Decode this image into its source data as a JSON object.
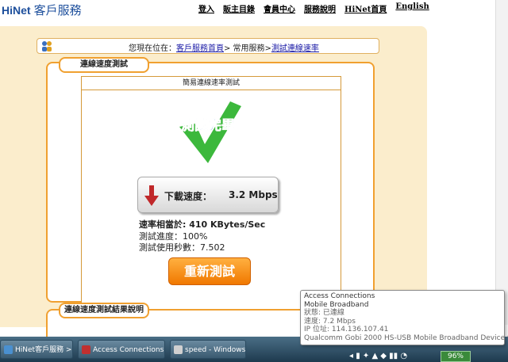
{
  "header": {
    "logo_text": "HiNet",
    "service_title": "客戶服務",
    "nav": [
      "登入",
      "販主目錄",
      "會員中心",
      "服務說明",
      "HiNet首頁",
      "English"
    ]
  },
  "breadcrumb": {
    "prefix": "您現在位在：",
    "home_link": "客戶服務首頁",
    "sep1": "> 常用服務>",
    "current_link": "測試連線速率"
  },
  "speed_panel": {
    "title": "連線速度測試",
    "inner_title": "簡易連線速率測試",
    "done_label": "測試完畢",
    "download_label": "下載速度：",
    "download_value": "3.2 Mbps",
    "equivalent": "速率相當於: 410 KBytes/Sec",
    "progress": "測試進度：100%",
    "elapsed": "測試使用秒數：7.502",
    "retest_button": "重新測試"
  },
  "result_panel": {
    "title": "連線速度測試結果說明"
  },
  "tooltip": {
    "lines": [
      "Access Connections",
      "Mobile Broadband",
      "狀態: 已連線",
      "速度: 7.2 Mbps",
      "IP 位址: 114.136.107.41",
      "Qualcomm Gobi 2000 HS-USB Mobile Broadband Device 9205"
    ]
  },
  "taskbar": {
    "tasks": [
      "HiNet客戶服務 > 常...",
      "Access Connections",
      "speed - Windows ..."
    ],
    "battery": "96%"
  },
  "colors": {
    "accent_orange": "#f0a030",
    "beige_bg": "#fbedcc",
    "link_blue": "#1a1aa6",
    "button_orange": "#f07800",
    "check_green": "#3cb83c"
  }
}
